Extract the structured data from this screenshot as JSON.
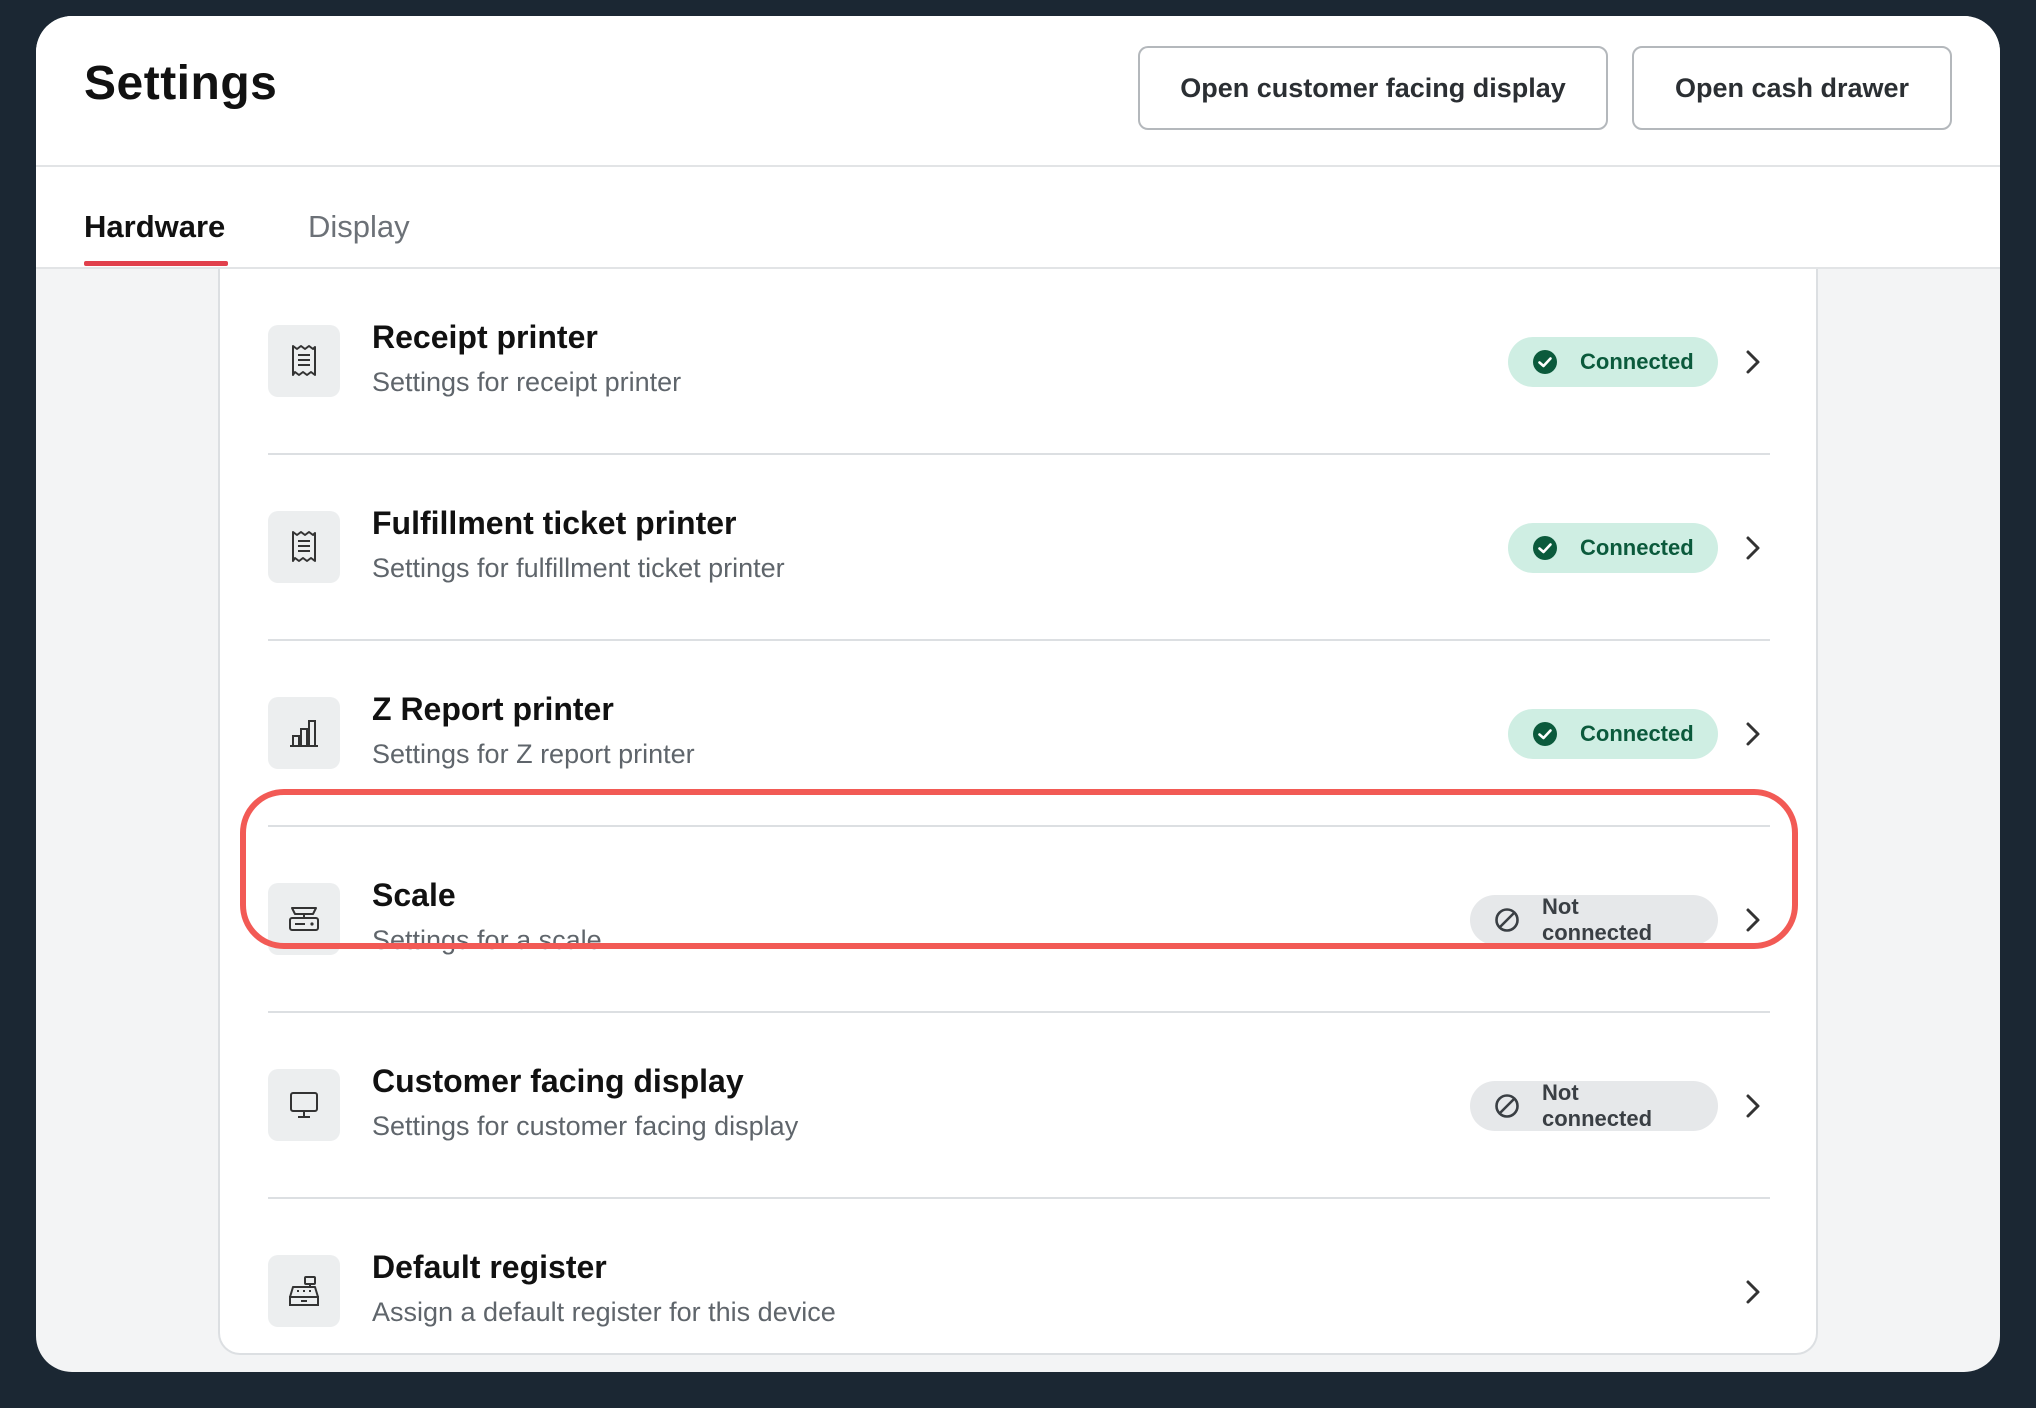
{
  "header": {
    "title": "Settings",
    "buttons": {
      "customer_display": "Open customer facing display",
      "cash_drawer": "Open cash drawer"
    }
  },
  "tabs": [
    {
      "label": "Hardware",
      "active": true
    },
    {
      "label": "Display",
      "active": false
    }
  ],
  "devices": [
    {
      "title": "Receipt printer",
      "subtitle": "Settings for receipt printer",
      "status": "Connected",
      "icon": "receipt-icon"
    },
    {
      "title": "Fulfillment ticket printer",
      "subtitle": "Settings for fulfillment ticket printer",
      "status": "Connected",
      "icon": "receipt-icon"
    },
    {
      "title": "Z Report printer",
      "subtitle": "Settings for Z report printer",
      "status": "Connected",
      "icon": "bar-chart-icon"
    },
    {
      "title": "Scale",
      "subtitle": "Settings for a scale",
      "status": "Not connected",
      "icon": "scale-icon"
    },
    {
      "title": "Customer facing display",
      "subtitle": "Settings for customer facing display",
      "status": "Not connected",
      "icon": "monitor-icon"
    },
    {
      "title": "Default register",
      "subtitle": "Assign a default register for this device",
      "status": "",
      "icon": "cash-register-icon"
    }
  ],
  "colors": {
    "connected_bg": "#cfeee3",
    "connected_text": "#0b5a3c",
    "not_connected_bg": "#e6e8ea",
    "tab_accent": "#e1404c",
    "highlight": "#f25a55"
  }
}
